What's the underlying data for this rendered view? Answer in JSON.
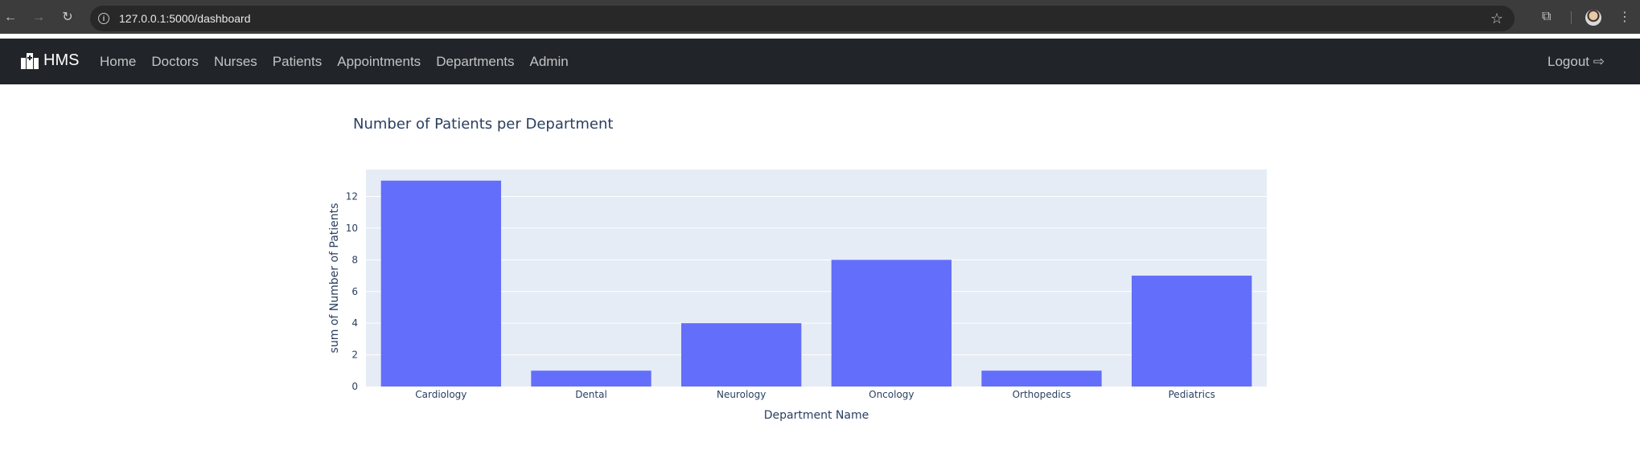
{
  "browser": {
    "url": "127.0.0.1:5000/dashboard"
  },
  "navbar": {
    "brand": "HMS",
    "links": [
      {
        "label": "Home"
      },
      {
        "label": "Doctors"
      },
      {
        "label": "Nurses"
      },
      {
        "label": "Patients"
      },
      {
        "label": "Appointments"
      },
      {
        "label": "Departments"
      },
      {
        "label": "Admin"
      }
    ],
    "logout_label": "Logout"
  },
  "chart_data": {
    "type": "bar",
    "title": "Number of Patients per Department",
    "xlabel": "Department Name",
    "ylabel": "sum of Number of Patients",
    "categories": [
      "Cardiology",
      "Dental",
      "Neurology",
      "Oncology",
      "Orthopedics",
      "Pediatrics"
    ],
    "values": [
      13,
      1,
      4,
      8,
      1,
      7
    ],
    "ylim": [
      0,
      13.7
    ],
    "yticks": [
      0,
      2,
      4,
      6,
      8,
      10,
      12
    ],
    "bar_color": "#636efa",
    "plot_bg": "#e5ecf6",
    "grid": true
  }
}
